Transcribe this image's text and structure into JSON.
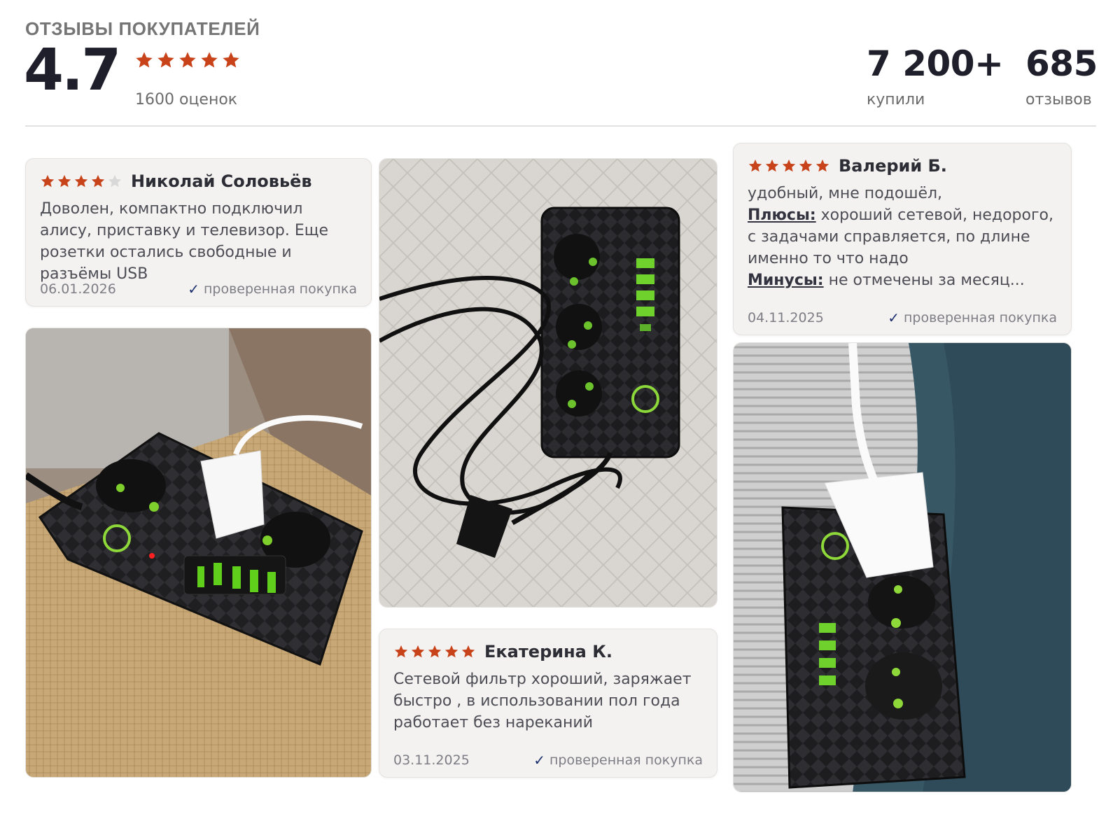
{
  "header": {
    "title": "ОТЗЫВЫ ПОКУПАТЕЛЕЙ",
    "rating": "4.7",
    "rating_stars": 5,
    "ratings_count": "1600 оценок"
  },
  "stats": {
    "bought_value": "7 200+",
    "bought_label": "купили",
    "reviews_value": "685",
    "reviews_label": "отзывов"
  },
  "colors": {
    "star_filled": "#c8431a",
    "star_empty": "#d8d8d8",
    "verified_check": "#1b2f6e"
  },
  "reviews": [
    {
      "name": "Николай Соловьёв",
      "stars": 4,
      "text": "Доволен, компактно подключил алису, приставку и телевизор. Еще розетки остались свободные и разъёмы USB",
      "date": "06.01.2026",
      "verified": "проверенная покупка"
    },
    {
      "name": "Валерий Б.",
      "stars": 5,
      "text_intro": "удобный, мне подошёл,",
      "pros_label": "Плюсы:",
      "pros_text": " хороший сетевой, недорого, с задачами справляется, по длине именно то что надо",
      "cons_label": "Минусы:",
      "cons_text": " не отмечены за месяц...",
      "date": "04.11.2025",
      "verified": "проверенная покупка"
    },
    {
      "name": "Екатерина К.",
      "stars": 5,
      "text": "Сетевой фильтр хороший, заряжает быстро , в использовании пол года работает без нареканий",
      "date": "03.11.2025",
      "verified": "проверенная покупка"
    }
  ],
  "photos": [
    {
      "icon": "power-strip-photo-1"
    },
    {
      "icon": "power-strip-photo-2"
    },
    {
      "icon": "power-strip-photo-3"
    }
  ]
}
